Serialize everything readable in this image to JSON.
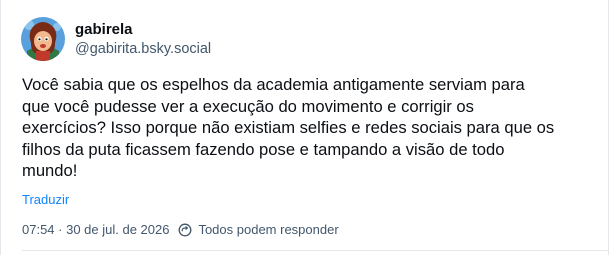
{
  "post": {
    "author": {
      "display_name": "gabirela",
      "handle": "@gabirita.bsky.social",
      "avatar_icon": "cartoon-avatar"
    },
    "text": "Você sabia que os espelhos da academia antigamente serviam para\nque você pudesse ver a execução do movimento e corrigir os\nexercícios? Isso porque não existiam selfies e redes sociais para que os\nfilhos da puta ficassem fazendo pose e tampando a visão de todo\nmundo!",
    "translate_label": "Traduzir",
    "timestamp": "07:54 · 30 de jul. de 2026",
    "reply_setting_icon": "reply-settings-icon",
    "reply_setting": "Todos podem responder"
  },
  "colors": {
    "text": "#0b0f14",
    "secondary_text": "#42576c",
    "link": "#1083fe",
    "divider": "#e4e8ec"
  }
}
